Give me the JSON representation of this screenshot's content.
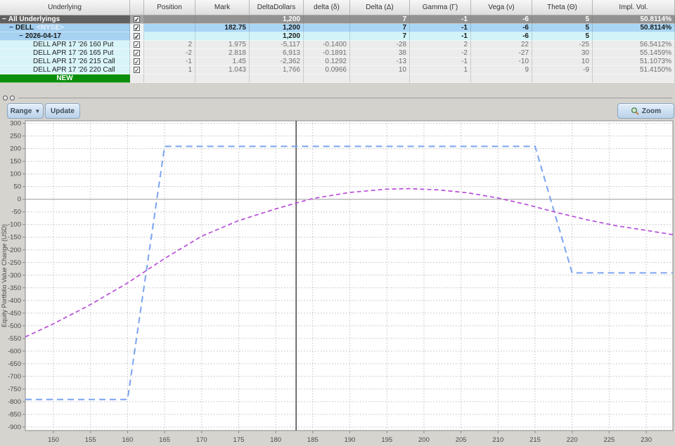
{
  "table": {
    "columns": [
      "Underlying",
      "",
      "Position",
      "Mark",
      "Delta\nDollars",
      "delta (δ)",
      "Delta (Δ)",
      "Gamma (Γ)",
      "Vega (ν)",
      "Theta (Θ)",
      "Impl. Vol."
    ],
    "rows": [
      {
        "label": "All Underlyings",
        "type": "all",
        "level": 0,
        "collapse_icon": true,
        "checked": true,
        "cells": [
          "",
          "",
          "1,200",
          "",
          "7",
          "-1",
          "-6",
          "5",
          "50.8114%"
        ]
      },
      {
        "label": "DELL",
        "suffix": "<NYSE>",
        "type": "dell",
        "level": 1,
        "collapse_icon": true,
        "checked": true,
        "cells": [
          "",
          "182.75",
          "1,200",
          "",
          "7",
          "-1",
          "-6",
          "5",
          "50.8114%"
        ]
      },
      {
        "label": "2026-04-17",
        "type": "date",
        "level": 2,
        "collapse_icon": true,
        "checked": true,
        "cells": [
          "",
          "",
          "1,200",
          "",
          "7",
          "-1",
          "-6",
          "5",
          ""
        ]
      },
      {
        "label": "DELL APR 17 '26 160 Put",
        "type": "option",
        "level": 3,
        "checked": true,
        "cells": [
          "2",
          "1.975",
          "-5,117",
          "-0.1400",
          "-28",
          "2",
          "22",
          "-25",
          "56.5412%"
        ]
      },
      {
        "label": "DELL APR 17 '26 165 Put",
        "type": "option",
        "level": 3,
        "checked": true,
        "cells": [
          "-2",
          "2.818",
          "6,913",
          "-0.1891",
          "38",
          "-2",
          "-27",
          "30",
          "55.1459%"
        ]
      },
      {
        "label": "DELL APR 17 '26 215 Call",
        "type": "option",
        "level": 3,
        "checked": true,
        "cells": [
          "-1",
          "1.45",
          "-2,362",
          "0.1292",
          "-13",
          "-1",
          "-10",
          "10",
          "51.1073%"
        ]
      },
      {
        "label": "DELL APR 17 '26 220 Call",
        "type": "option",
        "level": 3,
        "checked": true,
        "cells": [
          "1",
          "1.043",
          "1,766",
          "0.0966",
          "10",
          "1",
          "9",
          "-9",
          "51.4150%"
        ]
      },
      {
        "label": "NEW",
        "type": "new",
        "cells": [
          "",
          "",
          "",
          "",
          "",
          "",
          "",
          "",
          ""
        ]
      }
    ]
  },
  "toolbar": {
    "range": "Range",
    "update": "Update",
    "zoom": "Zoom"
  },
  "colors": {
    "group_row": "#929292",
    "underlying_row": "#a9d6f5",
    "expiry_row_cells": "#d2f4f8",
    "option_name_cells": "#d8f4f8",
    "new_row": "#0a8f0a",
    "expiration_line": "#7ba3f0",
    "current_line": "#b84fd8"
  },
  "chart_data": {
    "type": "line",
    "title": "",
    "xlabel": "",
    "ylabel": "Equity Portfolio Value Change (USD)",
    "grid": "dotted",
    "legend": "none",
    "xlim": [
      146.2,
      233.6
    ],
    "ylim": [
      -914,
      310
    ],
    "x_ticks": [
      150,
      155,
      160,
      165,
      170,
      175,
      180,
      185,
      190,
      195,
      200,
      205,
      210,
      215,
      220,
      225,
      230
    ],
    "y_ticks": [
      300,
      250,
      200,
      150,
      100,
      50,
      0,
      -50,
      -100,
      -150,
      -200,
      -250,
      -300,
      -350,
      -400,
      -450,
      -500,
      -550,
      -600,
      -650,
      -700,
      -750,
      -800,
      -850,
      -900
    ],
    "zero_line": 0,
    "current_price": 182.75,
    "series": [
      {
        "name": "expiration-pl",
        "color": "#7ba3f0",
        "dash": "9,6",
        "width": 2,
        "points": [
          [
            146.2,
            -791
          ],
          [
            160,
            -791
          ],
          [
            165,
            209
          ],
          [
            215,
            209
          ],
          [
            220,
            -291
          ],
          [
            233.6,
            -291
          ]
        ]
      },
      {
        "name": "current-pl",
        "color": "#b84fd8",
        "dash": "6,4",
        "width": 1.7,
        "points": [
          [
            146.2,
            -544
          ],
          [
            150,
            -492
          ],
          [
            155,
            -416
          ],
          [
            160,
            -331
          ],
          [
            165,
            -234
          ],
          [
            170,
            -146
          ],
          [
            175,
            -84
          ],
          [
            180,
            -38
          ],
          [
            182.75,
            -15
          ],
          [
            185,
            3
          ],
          [
            190,
            27
          ],
          [
            195,
            40
          ],
          [
            198,
            42
          ],
          [
            202,
            37
          ],
          [
            206,
            25
          ],
          [
            210,
            5
          ],
          [
            214,
            -22
          ],
          [
            218,
            -53
          ],
          [
            222,
            -81
          ],
          [
            226,
            -105
          ],
          [
            230,
            -123
          ],
          [
            233.6,
            -140
          ]
        ]
      }
    ]
  }
}
